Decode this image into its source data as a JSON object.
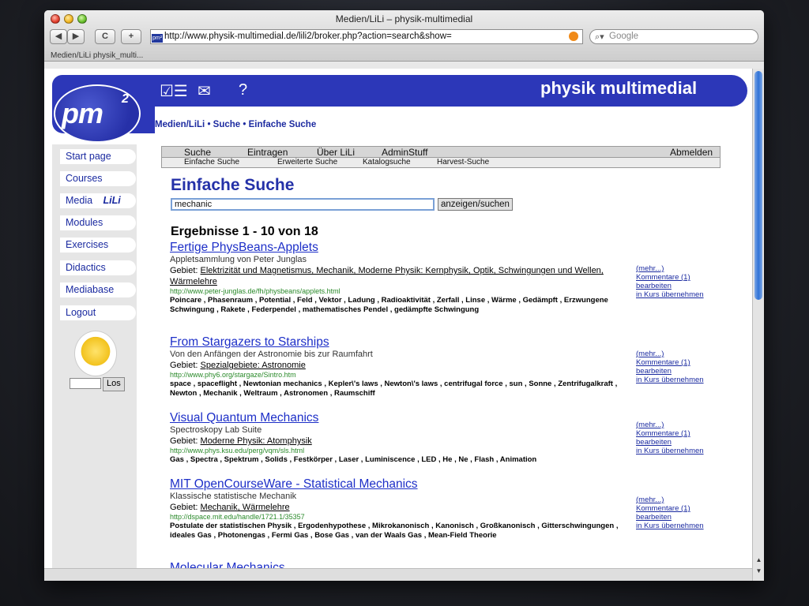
{
  "window": {
    "title": "Medien/LiLi – physik-multimedial",
    "url": "http://www.physik-multimedial.de/lili2/broker.php?action=search&show=",
    "search_placeholder": "Google",
    "tab_label": "Medien/LiLi    physik_multi...",
    "nav_back": "◀",
    "nav_forward": "▶",
    "reload": "C",
    "add": "+"
  },
  "header": {
    "logo": "pm",
    "logo_sup": "2",
    "site_title": "physik multimedial",
    "breadcrumb": "Medien/LiLi • Suche • Einfache Suche"
  },
  "sidebar": {
    "items": [
      "Start page",
      "Courses",
      "Media",
      "Modules",
      "Exercises",
      "Didactics",
      "Mediabase",
      "Logout"
    ],
    "media_badge": "LiLi",
    "search_button": "Los"
  },
  "tabs_main": [
    "Suche",
    "Eintragen",
    "Über LiLi",
    "AdminStuff",
    "Abmelden"
  ],
  "tabs_sub": [
    "Einfache Suche",
    "Erweiterte Suche",
    "Katalogsuche",
    "Harvest-Suche"
  ],
  "search": {
    "heading": "Einfache Suche",
    "query": "mechanic",
    "button": "anzeigen/suchen",
    "results_heading": "Ergebnisse 1 - 10 von 18"
  },
  "results": [
    {
      "title": "Fertige PhysBeans-Applets",
      "subtitle": "Appletsammlung von Peter Junglas",
      "gebiet_label": "Gebiet:",
      "gebiet": "Elektrizität und Magnetismus, Mechanik, Moderne Physik: Kernphysik, Optik, Schwingungen und Wellen, Wärmelehre",
      "url": "http://www.peter-junglas.de/fh/physbeans/applets.html",
      "keywords": "Poincare , Phasenraum , Potential , Feld , Vektor , Ladung , Radioaktivität , Zerfall , Linse , Wärme , Gedämpft , Erzwungene Schwingung , Rakete , Federpendel , mathematisches Pendel , gedämpfte Schwingung"
    },
    {
      "title": "From Stargazers to Starships",
      "subtitle": "Von den Anfängen der Astronomie bis zur Raumfahrt",
      "gebiet_label": "Gebiet:",
      "gebiet": "Spezialgebiete: Astronomie",
      "url": "http://www.phy6.org/stargaze/Sintro.htm",
      "keywords": "space , spaceflight , Newtonian mechanics , Kepler\\'s laws , Newton\\'s laws , centrifugal force , sun , Sonne , Zentrifugalkraft , Newton , Mechanik , Weltraum , Astronomen , Raumschiff"
    },
    {
      "title": "Visual Quantum Mechanics",
      "subtitle": "Spectroskopy Lab Suite",
      "gebiet_label": "Gebiet:",
      "gebiet": "Moderne Physik: Atomphysik",
      "url": "http://www.phys.ksu.edu/perg/vqm/sls.html",
      "keywords": "Gas , Spectra , Spektrum , Solids , Festkörper , Laser , Luminiscence , LED , He , Ne , Flash , Animation"
    },
    {
      "title": "MIT OpenCourseWare - Statistical Mechanics",
      "subtitle": "Klassische statistische Mechanik",
      "gebiet_label": "Gebiet:",
      "gebiet": "Mechanik, Wärmelehre",
      "url": "http://dspace.mit.edu/handle/1721.1/35357",
      "keywords": "Postulate der statistischen Physik , Ergodenhypothese , Mikrokanonisch , Kanonisch , Großkanonisch , Gitterschwingungen , ideales Gas , Photonengas , Fermi Gas , Bose Gas , van der Waals Gas , Mean-Field Theorie"
    },
    {
      "title": "Molecular Mechanics"
    }
  ],
  "actions": {
    "more": "(mehr...)",
    "comments": "Kommentare (1)",
    "edit": "bearbeiten",
    "add_to_course": "in Kurs übernehmen"
  }
}
